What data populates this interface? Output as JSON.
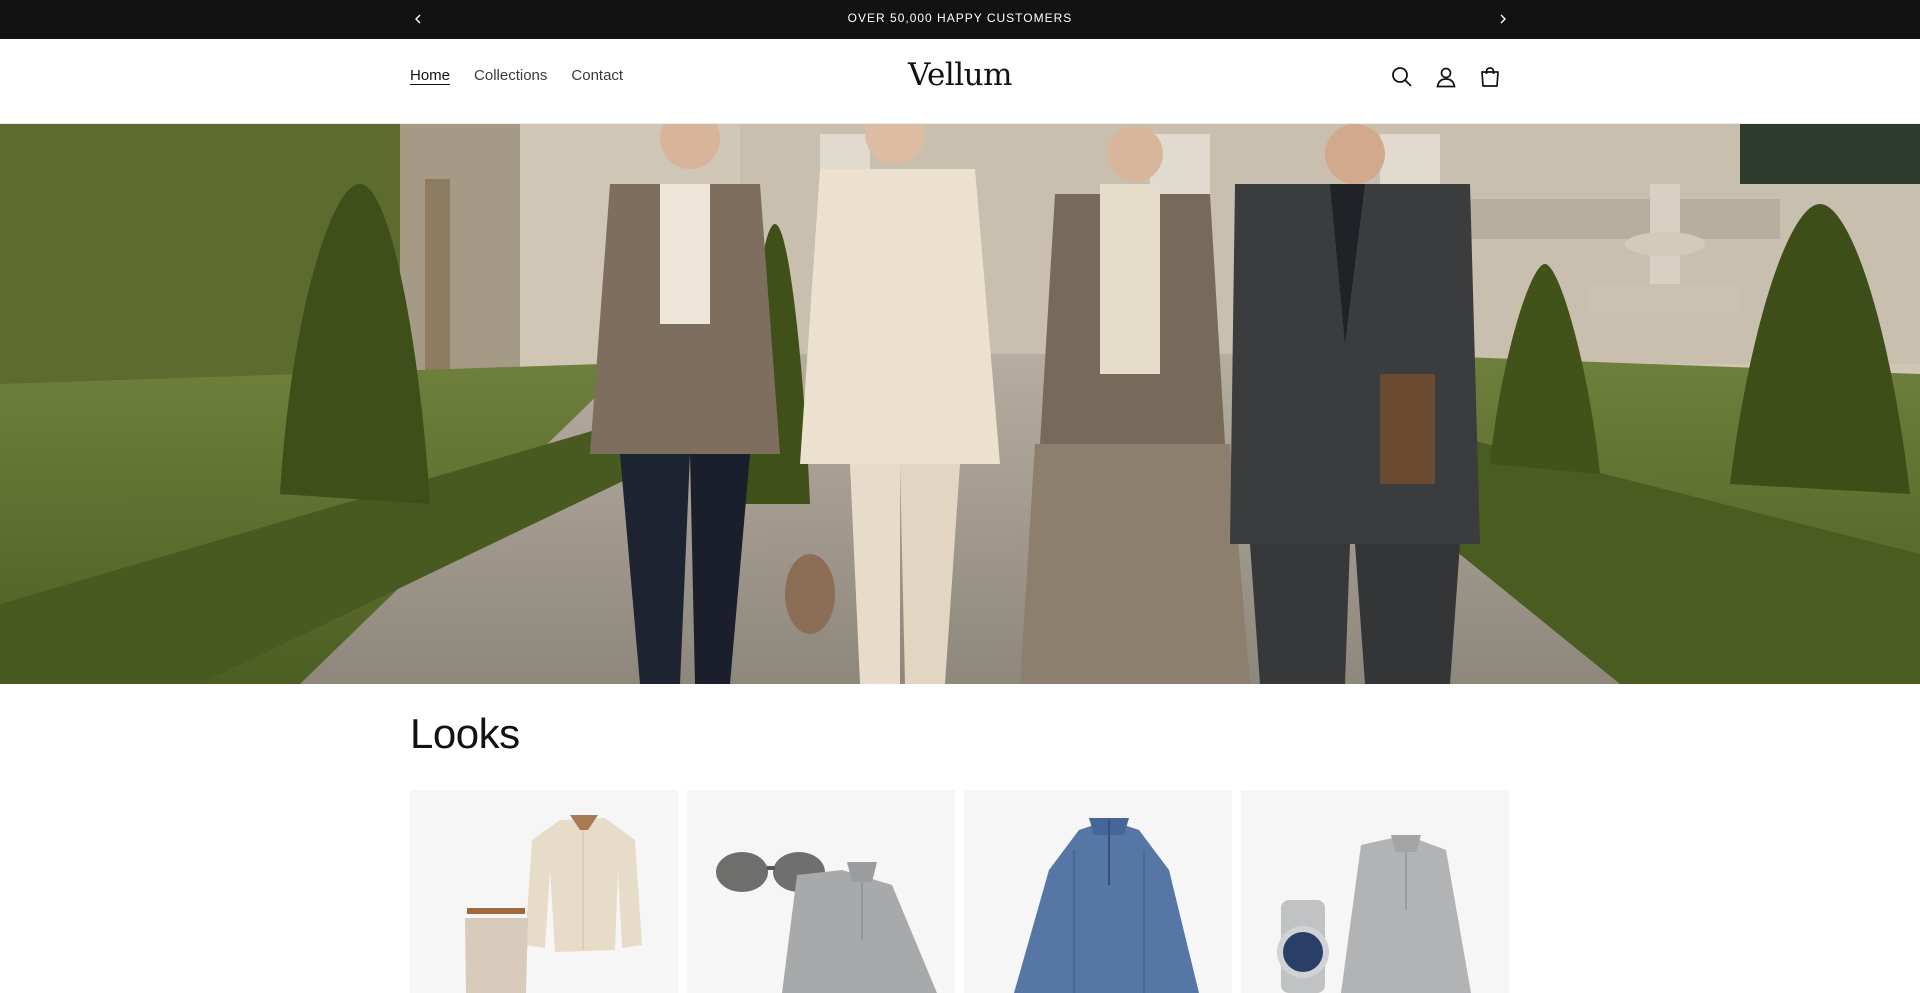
{
  "announcement": {
    "text": "OVER 50,000 HAPPY CUSTOMERS",
    "prev_icon": "chevron-left-icon",
    "next_icon": "chevron-right-icon"
  },
  "header": {
    "nav": [
      {
        "label": "Home",
        "active": true
      },
      {
        "label": "Collections",
        "active": false
      },
      {
        "label": "Contact",
        "active": false
      }
    ],
    "logo": "Vellum",
    "icons": [
      "search-icon",
      "account-icon",
      "cart-icon"
    ]
  },
  "looks": {
    "title": "Looks",
    "cards": [
      {
        "image": "linen-shirt-and-trousers"
      },
      {
        "image": "sunglasses-and-grey-half-zip"
      },
      {
        "image": "blue-cable-knit-half-zip"
      },
      {
        "image": "watch-and-grey-half-zip"
      }
    ]
  },
  "colors": {
    "announcement_bg": "#121212",
    "text": "#121212",
    "card_bg": "#f6f6f6"
  }
}
